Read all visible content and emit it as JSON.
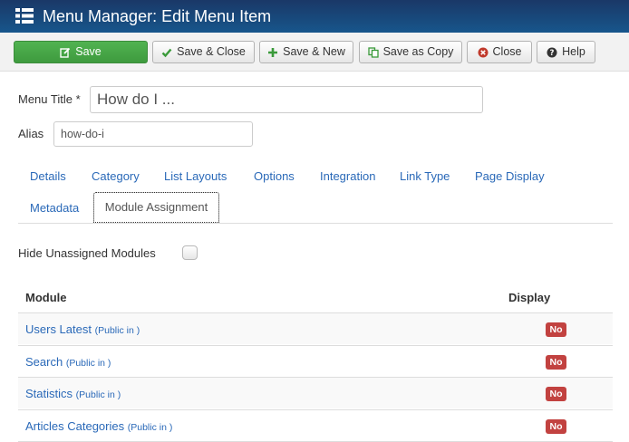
{
  "header": {
    "title": "Menu Manager: Edit Menu Item",
    "icon": "menu-list-icon"
  },
  "toolbar": {
    "save_label": "Save",
    "save_close_label": "Save & Close",
    "save_new_label": "Save & New",
    "save_copy_label": "Save as Copy",
    "close_label": "Close",
    "help_label": "Help",
    "save_color": "#46a546",
    "close_icon_color": "#c0392b"
  },
  "form": {
    "menu_title_label": "Menu Title *",
    "menu_title_value": "How do I ...",
    "alias_label": "Alias",
    "alias_value": "how-do-i"
  },
  "tabs": {
    "details": "Details",
    "category": "Category",
    "list_layouts": "List Layouts",
    "options": "Options",
    "integration": "Integration",
    "link_type": "Link Type",
    "page_display": "Page Display",
    "metadata": "Metadata",
    "module_assignment": "Module Assignment",
    "active": "Module Assignment"
  },
  "assignment": {
    "hide_unassigned_label": "Hide Unassigned Modules",
    "hide_unassigned_checked": false
  },
  "table": {
    "col_module": "Module",
    "col_display": "Display",
    "rows": [
      {
        "module": "Users Latest",
        "meta": "(Public in )",
        "display": "No"
      },
      {
        "module": "Search",
        "meta": "(Public in )",
        "display": "No"
      },
      {
        "module": "Statistics",
        "meta": "(Public in )",
        "display": "No"
      },
      {
        "module": "Articles Categories",
        "meta": "(Public in )",
        "display": "No"
      }
    ],
    "badge_color": "#c24240"
  }
}
